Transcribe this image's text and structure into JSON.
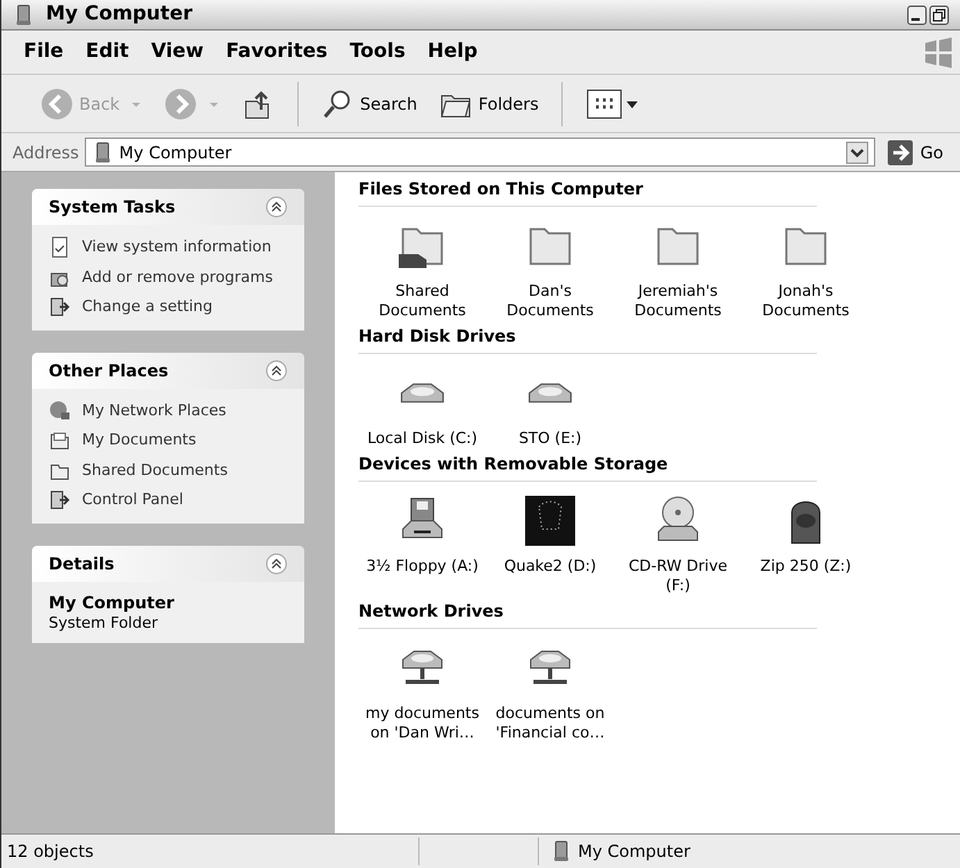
{
  "window": {
    "title": "My Computer"
  },
  "menu": [
    "File",
    "Edit",
    "View",
    "Favorites",
    "Tools",
    "Help"
  ],
  "toolbar": [
    {
      "kind": "back",
      "label": "Back",
      "disabled": true
    },
    {
      "kind": "forward",
      "disabled": true
    },
    {
      "kind": "up",
      "disabled": false
    },
    {
      "kind": "search",
      "label": "Search",
      "disabled": false
    },
    {
      "kind": "folders",
      "label": "Folders",
      "disabled": false
    },
    {
      "kind": "views",
      "disabled": false
    }
  ],
  "address": {
    "label": "Address",
    "value": "My Computer",
    "go": "Go"
  },
  "sidebar": [
    {
      "title": "System Tasks",
      "kind": "links",
      "items": [
        {
          "kind": "info",
          "label": "View system information"
        },
        {
          "kind": "programs",
          "label": "Add or remove programs"
        },
        {
          "kind": "setting",
          "label": "Change a setting"
        }
      ]
    },
    {
      "title": "Other Places",
      "kind": "links",
      "items": [
        {
          "kind": "network",
          "label": "My Network Places"
        },
        {
          "kind": "documents",
          "label": "My Documents"
        },
        {
          "kind": "folder",
          "label": "Shared Documents"
        },
        {
          "kind": "setting",
          "label": "Control Panel"
        }
      ]
    },
    {
      "title": "Details",
      "kind": "details",
      "name": "My Computer",
      "type": "System Folder"
    }
  ],
  "sections": [
    {
      "title": "Files Stored on This Computer",
      "items": [
        {
          "kind": "shared-folder",
          "label": "Shared Documents"
        },
        {
          "kind": "folder",
          "label": "Dan's Documents"
        },
        {
          "kind": "folder",
          "label": "Jeremiah's Documents"
        },
        {
          "kind": "folder",
          "label": "Jonah's Documents"
        }
      ]
    },
    {
      "title": "Hard Disk Drives",
      "items": [
        {
          "kind": "disk",
          "label": "Local Disk (C:)"
        },
        {
          "kind": "disk",
          "label": "STO (E:)"
        }
      ]
    },
    {
      "title": "Devices with Removable Storage",
      "items": [
        {
          "kind": "floppy",
          "label": "3½ Floppy (A:)"
        },
        {
          "kind": "custom",
          "label": "Quake2 (D:)"
        },
        {
          "kind": "cd",
          "label": "CD-RW Drive (F:)"
        },
        {
          "kind": "zip",
          "label": "Zip 250  (Z:)"
        }
      ]
    },
    {
      "title": "Network Drives",
      "items": [
        {
          "kind": "network-drive",
          "label": "my documents on 'Dan Wri…"
        },
        {
          "kind": "network-drive",
          "label": "documents on 'Financial co…"
        }
      ]
    }
  ],
  "status_bar": {
    "count": "12 objects",
    "location": "My Computer"
  }
}
